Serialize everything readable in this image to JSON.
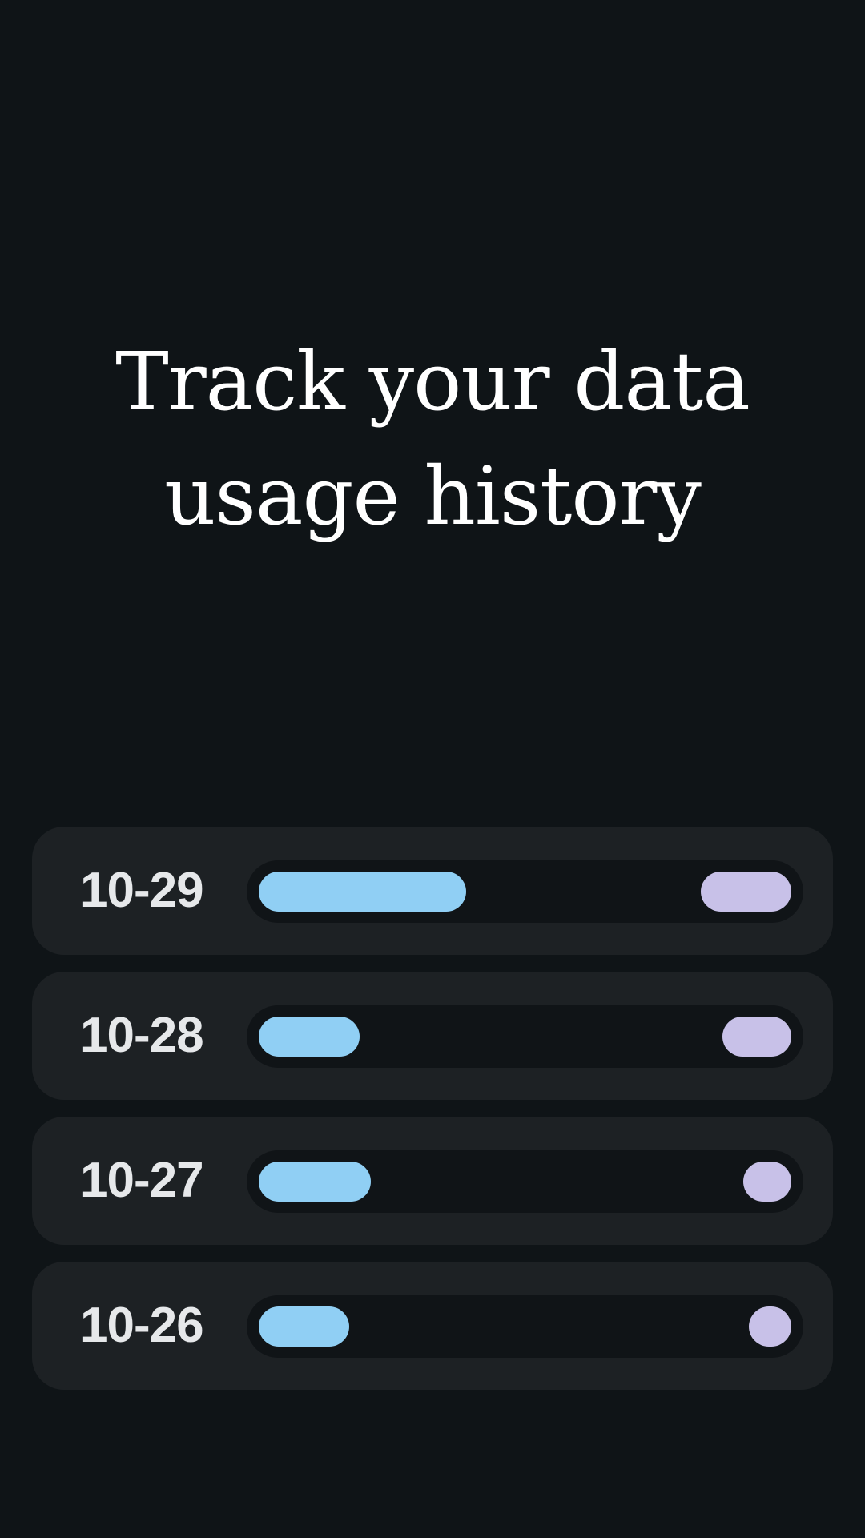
{
  "headline": {
    "line1": "Track your data",
    "line2": "usage history"
  },
  "colors": {
    "background": "#0f1417",
    "card": "#1d2124",
    "track": "#101417",
    "primary_bar": "#90cff4",
    "secondary_bar": "#c8c1e8"
  },
  "history": [
    {
      "date": "10-29",
      "primary_fraction": 0.39,
      "secondary_fraction": 0.17
    },
    {
      "date": "10-28",
      "primary_fraction": 0.19,
      "secondary_fraction": 0.13
    },
    {
      "date": "10-27",
      "primary_fraction": 0.21,
      "secondary_fraction": 0.09
    },
    {
      "date": "10-26",
      "primary_fraction": 0.17,
      "secondary_fraction": 0.08
    }
  ]
}
